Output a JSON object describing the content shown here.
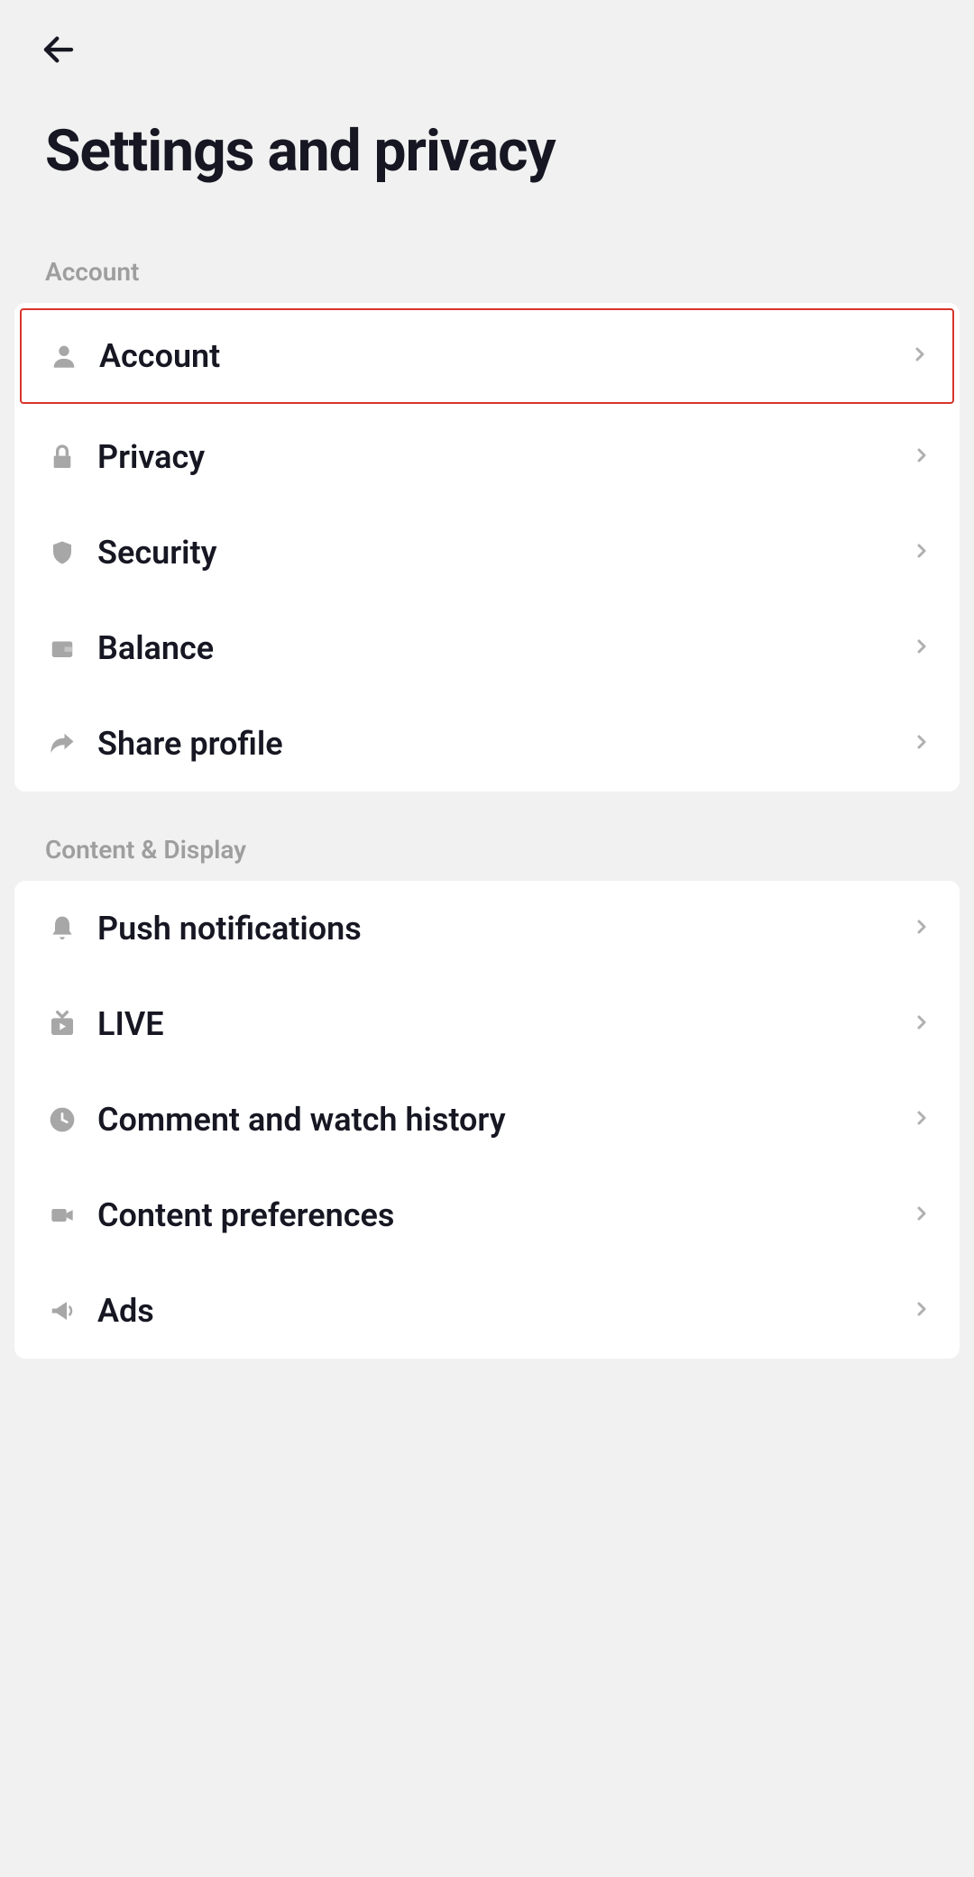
{
  "header": {
    "title": "Settings and privacy"
  },
  "sections": {
    "account": {
      "header": "Account",
      "items": [
        {
          "label": "Account"
        },
        {
          "label": "Privacy"
        },
        {
          "label": "Security"
        },
        {
          "label": "Balance"
        },
        {
          "label": "Share profile"
        }
      ]
    },
    "content_display": {
      "header": "Content & Display",
      "items": [
        {
          "label": "Push notifications"
        },
        {
          "label": "LIVE"
        },
        {
          "label": "Comment and watch history"
        },
        {
          "label": "Content preferences"
        },
        {
          "label": "Ads"
        }
      ]
    }
  }
}
